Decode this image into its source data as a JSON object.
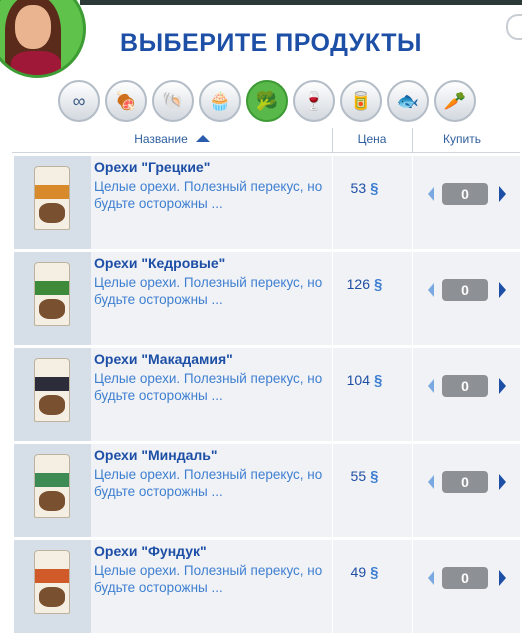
{
  "window": {
    "title": "ВЫБЕРИТЕ ПРОДУКТЫ"
  },
  "categories": [
    {
      "icon": "infinity-icon",
      "glyph": "∞",
      "active": false
    },
    {
      "icon": "meat-icon",
      "glyph": "🍖",
      "active": false
    },
    {
      "icon": "seafood-shell-icon",
      "glyph": "🐚",
      "active": false
    },
    {
      "icon": "cupcake-icon",
      "glyph": "🧁",
      "active": false
    },
    {
      "icon": "vegetables-icon",
      "glyph": "🥦",
      "active": true
    },
    {
      "icon": "wine-glass-icon",
      "glyph": "🍷",
      "active": false
    },
    {
      "icon": "can-icon",
      "glyph": "🥫",
      "active": false
    },
    {
      "icon": "fish-icon",
      "glyph": "🐟",
      "active": false
    },
    {
      "icon": "carrot-icon",
      "glyph": "🥕",
      "active": false
    }
  ],
  "table": {
    "columns": {
      "name": "Название",
      "price": "Цена",
      "buy": "Купить"
    },
    "sort": "name-ascending",
    "currency_symbol": "§",
    "rows": [
      {
        "name": "Орехи \"Грецкие\"",
        "desc": "Целые орехи. Полезный перекус, но будьте осторожны ...",
        "price": "53",
        "qty": "0",
        "band_color": "#d88a2b"
      },
      {
        "name": "Орехи \"Кедровые\"",
        "desc": "Целые орехи. Полезный перекус, но будьте осторожны ...",
        "price": "126",
        "qty": "0",
        "band_color": "#3f8a3a"
      },
      {
        "name": "Орехи \"Макадамия\"",
        "desc": "Целые орехи. Полезный перекус, но будьте осторожны ...",
        "price": "104",
        "qty": "0",
        "band_color": "#2c2c3a"
      },
      {
        "name": "Орехи \"Миндаль\"",
        "desc": "Целые орехи. Полезный перекус, но будьте осторожны ...",
        "price": "55",
        "qty": "0",
        "band_color": "#3d8a55"
      },
      {
        "name": "Орехи \"Фундук\"",
        "desc": "Целые орехи. Полезный перекус, но будьте осторожны ...",
        "price": "49",
        "qty": "0",
        "band_color": "#d05a2a"
      }
    ]
  }
}
